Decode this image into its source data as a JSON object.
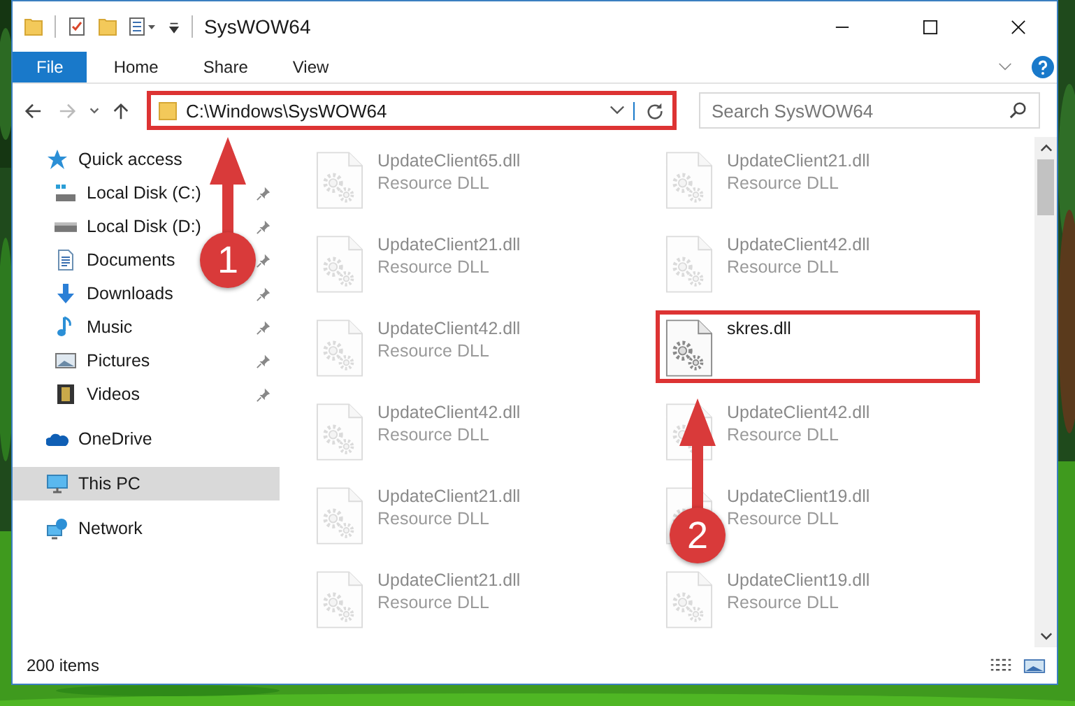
{
  "window": {
    "title": "SysWOW64"
  },
  "ribbon_tabs": [
    {
      "label": "File",
      "selected": true
    },
    {
      "label": "Home",
      "selected": false
    },
    {
      "label": "Share",
      "selected": false
    },
    {
      "label": "View",
      "selected": false
    }
  ],
  "address": {
    "path": "C:\\Windows\\SysWOW64",
    "highlighted": true
  },
  "search": {
    "placeholder": "Search SysWOW64"
  },
  "sidebar": {
    "items": [
      {
        "label": "Quick access",
        "kind": "star",
        "selected": false,
        "children": [
          {
            "label": "Local Disk (C:)",
            "kind": "system-drive",
            "pinned": true,
            "selected": false
          },
          {
            "label": "Local Disk (D:)",
            "kind": "drive",
            "pinned": true,
            "selected": false
          },
          {
            "label": "Documents",
            "kind": "documents",
            "pinned": true,
            "selected": false
          },
          {
            "label": "Downloads",
            "kind": "downloads",
            "pinned": true,
            "selected": false
          },
          {
            "label": "Music",
            "kind": "music",
            "pinned": true,
            "selected": false
          },
          {
            "label": "Pictures",
            "kind": "pictures",
            "pinned": true,
            "selected": false
          },
          {
            "label": "Videos",
            "kind": "videos",
            "pinned": true,
            "selected": false
          }
        ]
      },
      {
        "label": "OneDrive",
        "kind": "cloud",
        "selected": false
      },
      {
        "label": "This PC",
        "kind": "computer",
        "selected": true
      },
      {
        "label": "Network",
        "kind": "network",
        "selected": false
      }
    ]
  },
  "files": [
    {
      "name": "UpdateClient65.dll",
      "type": "Resource DLL",
      "dimmed": true,
      "highlighted": false
    },
    {
      "name": "UpdateClient21.dll",
      "type": "Resource DLL",
      "dimmed": true,
      "highlighted": false
    },
    {
      "name": "UpdateClient21.dll",
      "type": "Resource DLL",
      "dimmed": true,
      "highlighted": false
    },
    {
      "name": "UpdateClient42.dll",
      "type": "Resource DLL",
      "dimmed": true,
      "highlighted": false
    },
    {
      "name": "UpdateClient42.dll",
      "type": "Resource DLL",
      "dimmed": true,
      "highlighted": false
    },
    {
      "name": "skres.dll",
      "dimmed": false,
      "highlighted": true
    },
    {
      "name": "UpdateClient42.dll",
      "type": "Resource DLL",
      "dimmed": true,
      "highlighted": false
    },
    {
      "name": "UpdateClient42.dll",
      "type": "Resource DLL",
      "dimmed": true,
      "highlighted": false
    },
    {
      "name": "UpdateClient21.dll",
      "type": "Resource DLL",
      "dimmed": true,
      "highlighted": false
    },
    {
      "name": "UpdateClient19.dll",
      "type": "Resource DLL",
      "dimmed": true,
      "highlighted": false
    },
    {
      "name": "UpdateClient21.dll",
      "type": "Resource DLL",
      "dimmed": true,
      "highlighted": false
    },
    {
      "name": "UpdateClient19.dll",
      "type": "Resource DLL",
      "dimmed": true,
      "highlighted": false
    }
  ],
  "status_bar": {
    "item_count": "200 items"
  },
  "annotations": [
    {
      "number": "1"
    },
    {
      "number": "2"
    }
  ]
}
